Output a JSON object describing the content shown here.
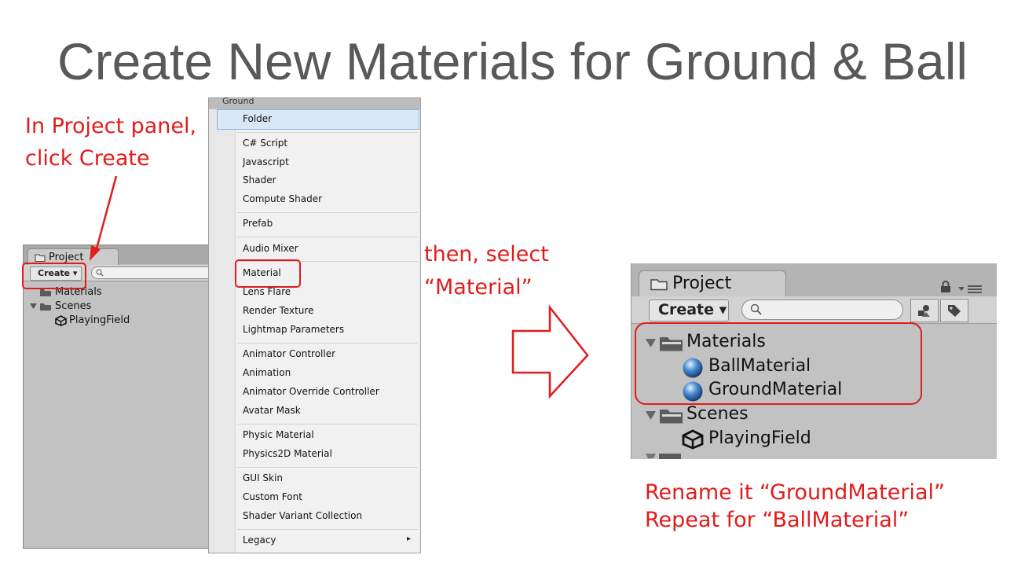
{
  "title": "Create New Materials for Ground & Ball",
  "notes": {
    "step1_line1": "In Project panel,",
    "step1_line2": "click Create",
    "step2_line1": "then, select",
    "step2_line2": "“Material”",
    "step3_line1": "Rename it “GroundMaterial”",
    "step3_line2": "Repeat for “BallMaterial”"
  },
  "left_panel": {
    "tab_label": "Project",
    "create_label": "Create ▾",
    "tree": [
      {
        "label": "Materials",
        "icon": "folder-icon"
      },
      {
        "label": "Scenes",
        "icon": "folder-icon"
      },
      {
        "label": "PlayingField",
        "icon": "unity-scene-icon"
      }
    ]
  },
  "menu": {
    "header": "Ground",
    "items": [
      "Folder",
      "C# Script",
      "Javascript",
      "Shader",
      "Compute Shader",
      "Prefab",
      "Audio Mixer",
      "Material",
      "Lens Flare",
      "Render Texture",
      "Lightmap Parameters",
      "Animator Controller",
      "Animation",
      "Animator Override Controller",
      "Avatar Mask",
      "Physic Material",
      "Physics2D Material",
      "GUI Skin",
      "Custom Font",
      "Shader Variant Collection",
      "Legacy"
    ],
    "submenu_arrow": "▸"
  },
  "right_panel": {
    "tab_label": "Project",
    "create_label": "Create ▾",
    "tree": [
      {
        "label": "Materials",
        "icon": "folder-icon"
      },
      {
        "label": "BallMaterial",
        "icon": "material-sphere-icon"
      },
      {
        "label": "GroundMaterial",
        "icon": "material-sphere-icon"
      },
      {
        "label": "Scenes",
        "icon": "folder-icon"
      },
      {
        "label": "PlayingField",
        "icon": "unity-scene-icon"
      }
    ]
  },
  "colors": {
    "annotation": "#e21b1b",
    "title": "#595959",
    "menu_highlight": "#d8e8f6"
  }
}
